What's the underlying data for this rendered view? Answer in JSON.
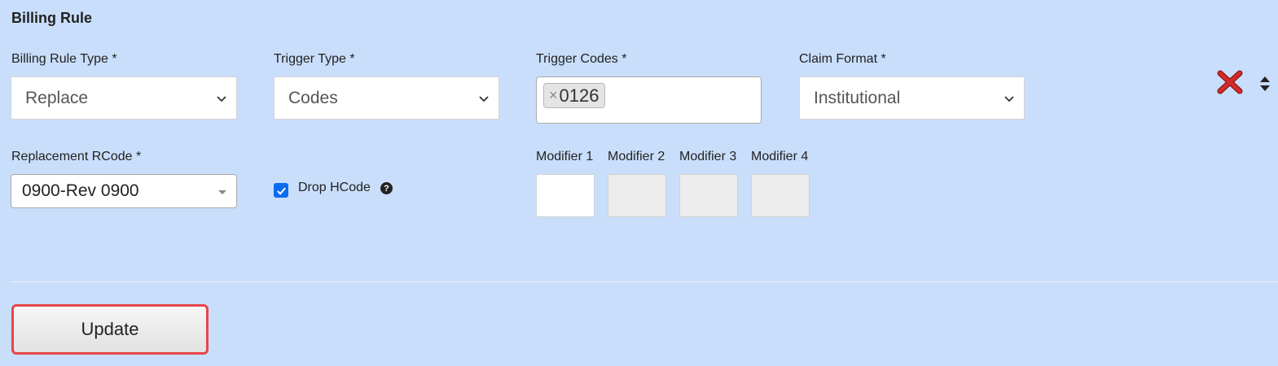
{
  "section": {
    "title": "Billing Rule"
  },
  "fields": {
    "billing_rule_type": {
      "label": "Billing Rule Type *",
      "value": "Replace"
    },
    "trigger_type": {
      "label": "Trigger Type *",
      "value": "Codes"
    },
    "trigger_codes": {
      "label": "Trigger Codes *",
      "tags": [
        {
          "remove": "×",
          "value": "0126"
        }
      ]
    },
    "claim_format": {
      "label": "Claim Format *",
      "value": "Institutional"
    },
    "replacement_rcode": {
      "label": "Replacement RCode *",
      "value": "0900-Rev 0900"
    },
    "drop_hcode": {
      "label": "Drop HCode",
      "checked": true,
      "help_icon": "question-circle-icon"
    },
    "modifiers": [
      {
        "label": "Modifier 1",
        "value": "",
        "enabled": true
      },
      {
        "label": "Modifier 2",
        "value": "",
        "enabled": false
      },
      {
        "label": "Modifier 3",
        "value": "",
        "enabled": false
      },
      {
        "label": "Modifier 4",
        "value": "",
        "enabled": false
      }
    ]
  },
  "actions": {
    "remove_icon": "red-x-icon",
    "sort_icon": "sort-updown-icon",
    "update_label": "Update"
  },
  "colors": {
    "background": "#c9defb",
    "remove": "#cc1f1f",
    "checkbox": "#0b6bf0",
    "highlight": "#e8464a"
  }
}
